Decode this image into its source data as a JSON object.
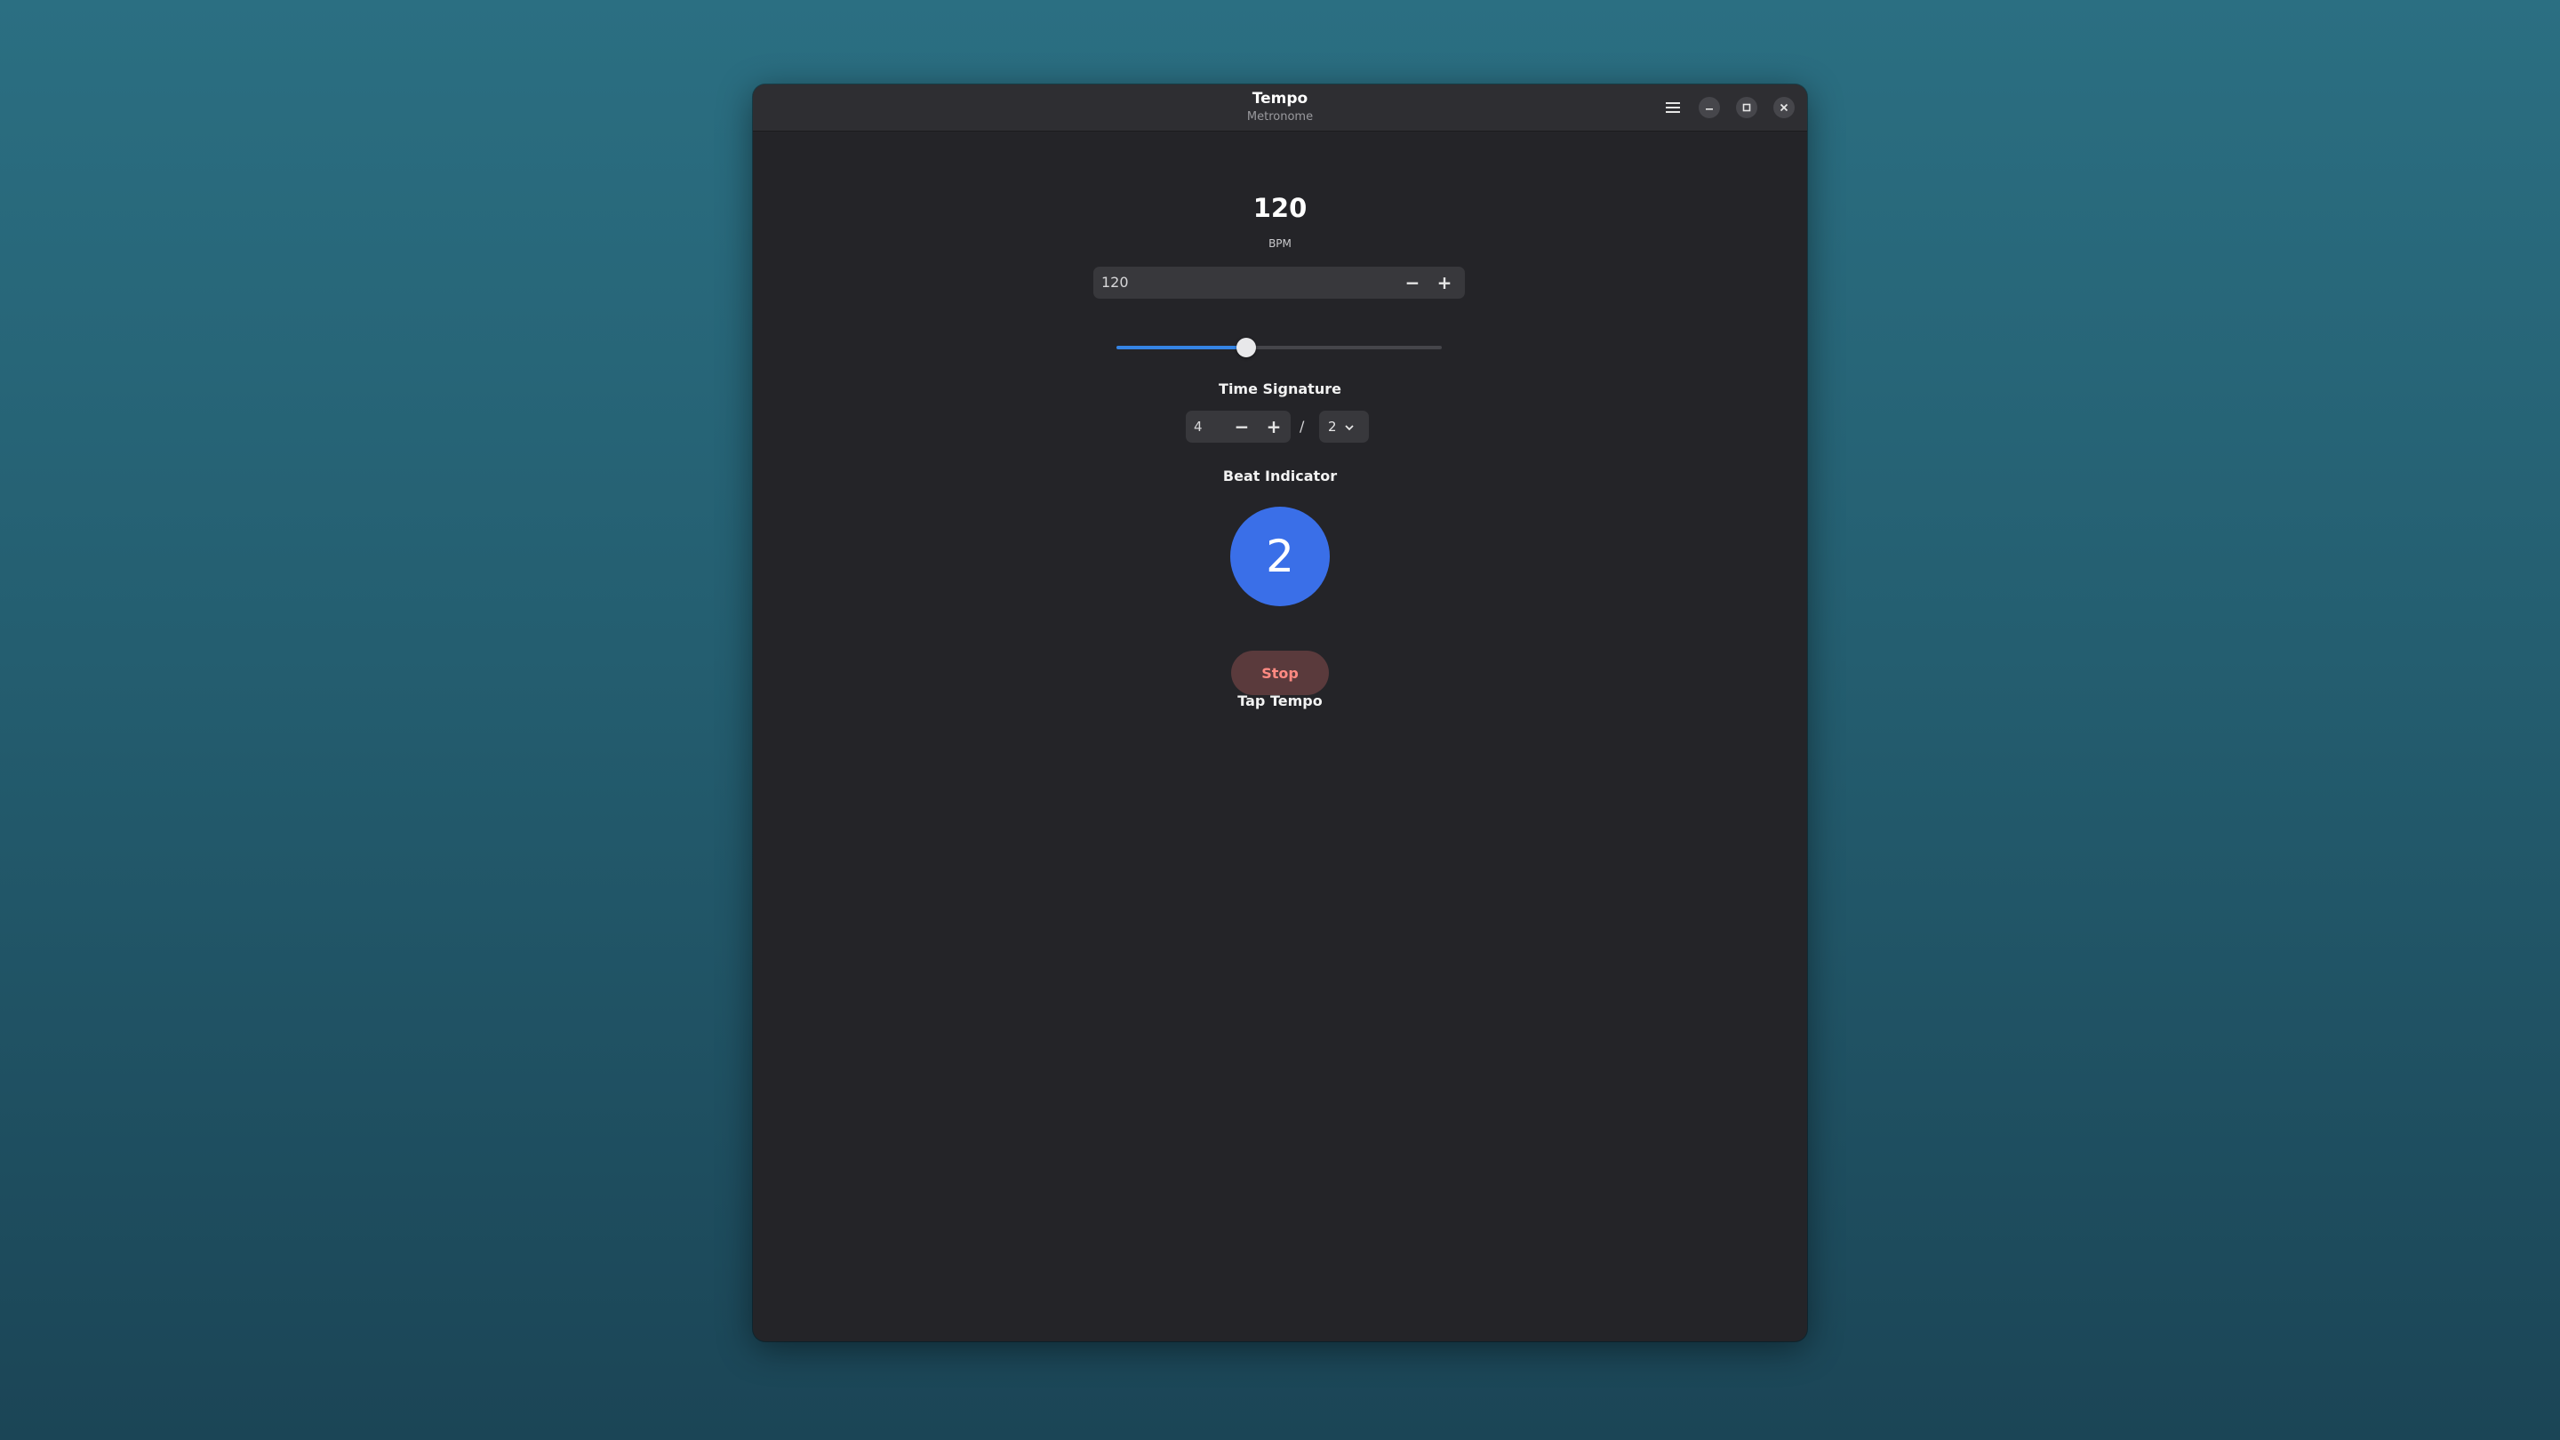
{
  "window": {
    "title": "Tempo",
    "subtitle": "Metronome"
  },
  "header_buttons": {
    "menu_icon": "hamburger-menu-icon",
    "minimize_icon": "minimize-icon",
    "maximize_icon": "maximize-icon",
    "close_icon": "close-icon"
  },
  "bpm": {
    "display": "120",
    "unit": "BPM",
    "spin_value": "120",
    "decrement": "−",
    "increment": "+",
    "slider_level": 0.4
  },
  "time_signature": {
    "label": "Time Signature",
    "beats": "4",
    "decrement": "−",
    "increment": "+",
    "separator": "/",
    "note_value": "2",
    "dropdown_icon": "chevron-down-icon"
  },
  "beat_indicator": {
    "label": "Beat Indicator",
    "current_beat": "2"
  },
  "controls": {
    "stop_label": "Stop",
    "tap_tempo_label": "Tap Tempo"
  },
  "colors": {
    "accent": "#3584e4",
    "beat_circle": "#3a6fe8",
    "stop_text": "#ff8a82",
    "stop_bg": "#5a3a3c",
    "window_bg": "#242428"
  }
}
